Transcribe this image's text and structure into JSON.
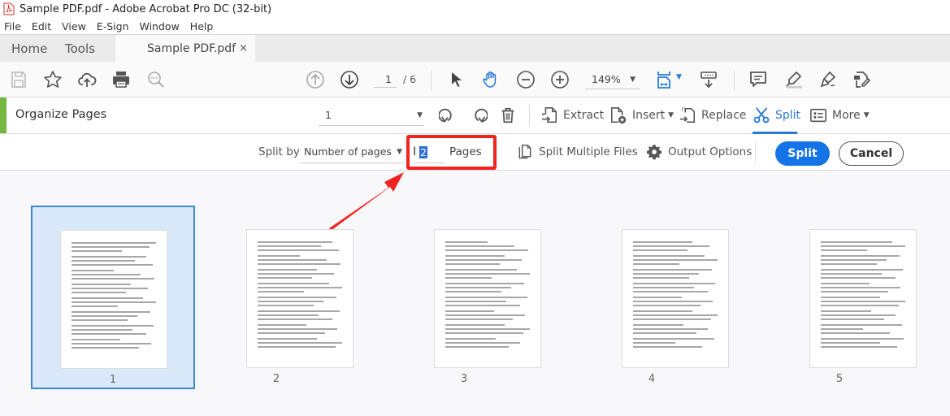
{
  "window": {
    "title": "Sample PDF.pdf - Adobe Acrobat Pro DC (32-bit)",
    "app_icon": "acrobat-pdf-icon"
  },
  "menu": [
    "File",
    "Edit",
    "View",
    "E-Sign",
    "Window",
    "Help"
  ],
  "tabs": {
    "home": "Home",
    "tools": "Tools",
    "document": "Sample PDF.pdf",
    "close": "×"
  },
  "toolbar": {
    "icons": [
      "save-icon",
      "bookmark-star-icon",
      "cloud-upload-icon",
      "print-icon",
      "search-zoom-icon",
      "previous-page-icon",
      "next-page-icon",
      "select-cursor-icon",
      "hand-tool-icon",
      "zoom-out-icon",
      "zoom-in-icon",
      "fit-page-icon",
      "scroll-mode-icon",
      "comment-icon",
      "highlight-icon",
      "sign-icon",
      "fill-sign-icon"
    ],
    "current_page": "1",
    "total_pages": "/ 6",
    "zoom": "149%"
  },
  "organize": {
    "title": "Organize Pages",
    "page_select": "1",
    "buttons": {
      "extract": "Extract",
      "insert": "Insert",
      "replace": "Replace",
      "split": "Split",
      "more": "More"
    },
    "active_tool": "Split"
  },
  "split": {
    "split_by_label": "Split by",
    "split_by_value": "Number of pages",
    "number_value": "2",
    "pages_label": "Pages",
    "split_multiple": "Split Multiple Files",
    "output_options": "Output Options",
    "split_button": "Split",
    "cancel_button": "Cancel"
  },
  "annotation": {
    "highlight_color": "#f0231e"
  },
  "colors": {
    "accent_blue": "#1473e6",
    "organize_green": "#74b842",
    "selection_bg": "#d9e9fa"
  },
  "thumbnails": [
    {
      "label": "1",
      "selected": true
    },
    {
      "label": "2",
      "selected": false
    },
    {
      "label": "3",
      "selected": false
    },
    {
      "label": "4",
      "selected": false
    },
    {
      "label": "5",
      "selected": false
    }
  ]
}
